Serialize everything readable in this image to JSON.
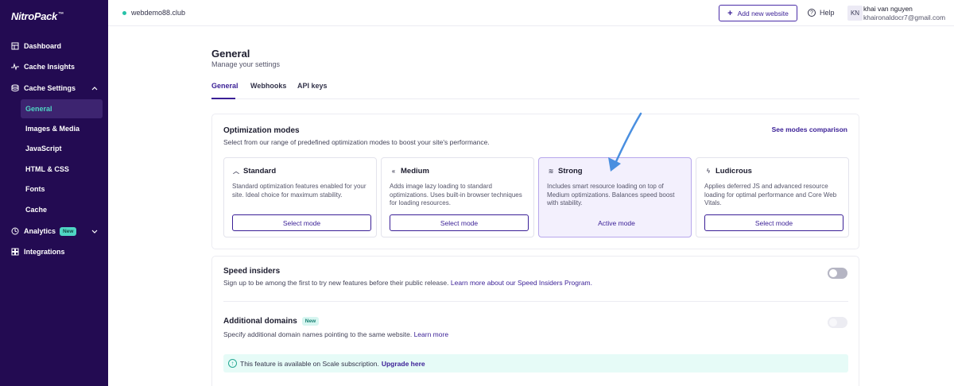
{
  "sidebar": {
    "logo": "NitroPack",
    "logo_sup": "™",
    "items": [
      {
        "label": "Dashboard",
        "icon": "dashboard-icon"
      },
      {
        "label": "Cache Insights",
        "icon": "pulse-icon"
      },
      {
        "label": "Cache Settings",
        "icon": "database-icon",
        "expanded": true
      },
      {
        "label": "Analytics",
        "icon": "clock-chart-icon",
        "badge": "New"
      },
      {
        "label": "Integrations",
        "icon": "puzzle-icon"
      }
    ],
    "sub_items": [
      {
        "label": "General",
        "active": true
      },
      {
        "label": "Images & Media"
      },
      {
        "label": "JavaScript"
      },
      {
        "label": "HTML & CSS"
      },
      {
        "label": "Fonts"
      },
      {
        "label": "Cache"
      }
    ]
  },
  "topbar": {
    "site": "webdemo88.club",
    "add_site_label": "Add new website",
    "help_label": "Help",
    "avatar_initials": "KN",
    "user_name": "khai van nguyen",
    "user_email": "khaironaldocr7@gmail.com"
  },
  "page": {
    "title": "General",
    "subtitle": "Manage your settings",
    "tabs": [
      "General",
      "Webhooks",
      "API keys"
    ],
    "active_tab": "General"
  },
  "optimization": {
    "title": "Optimization modes",
    "description": "Select from our range of predefined optimization modes to boost your site's performance.",
    "compare_link": "See modes comparison",
    "modes": [
      {
        "name": "Standard",
        "icon": "chevron-up-icon",
        "description": "Standard optimization features enabled for your site. Ideal choice for maximum stability.",
        "action": "Select mode"
      },
      {
        "name": "Medium",
        "icon": "double-chevron-up-icon",
        "description": "Adds image lazy loading to standard optimizations. Uses built-in browser techniques for loading resources.",
        "action": "Select mode"
      },
      {
        "name": "Strong",
        "icon": "triple-chevron-up-icon",
        "description": "Includes smart resource loading on top of Medium optimizations. Balances speed boost with stability.",
        "action": "Active mode",
        "active": true
      },
      {
        "name": "Ludicrous",
        "icon": "lightning-icon",
        "description": "Applies deferred JS and advanced resource loading for optimal performance and Core Web Vitals.",
        "action": "Select mode"
      }
    ]
  },
  "speed_insiders": {
    "title": "Speed insiders",
    "description": "Sign up to be among the first to try new features before their public release.",
    "link": "Learn more about our Speed Insiders Program.",
    "enabled": false
  },
  "additional_domains": {
    "title": "Additional domains",
    "badge": "New",
    "description": "Specify additional domain names pointing to the same website.",
    "link": "Learn more",
    "enabled": false,
    "notice": "This feature is available on Scale subscription.",
    "notice_link": "Upgrade here"
  },
  "colors": {
    "sidebar_bg": "#230b52",
    "accent": "#3a1f96",
    "teal": "#4fd6c4",
    "arrow": "#4a8fe0"
  }
}
